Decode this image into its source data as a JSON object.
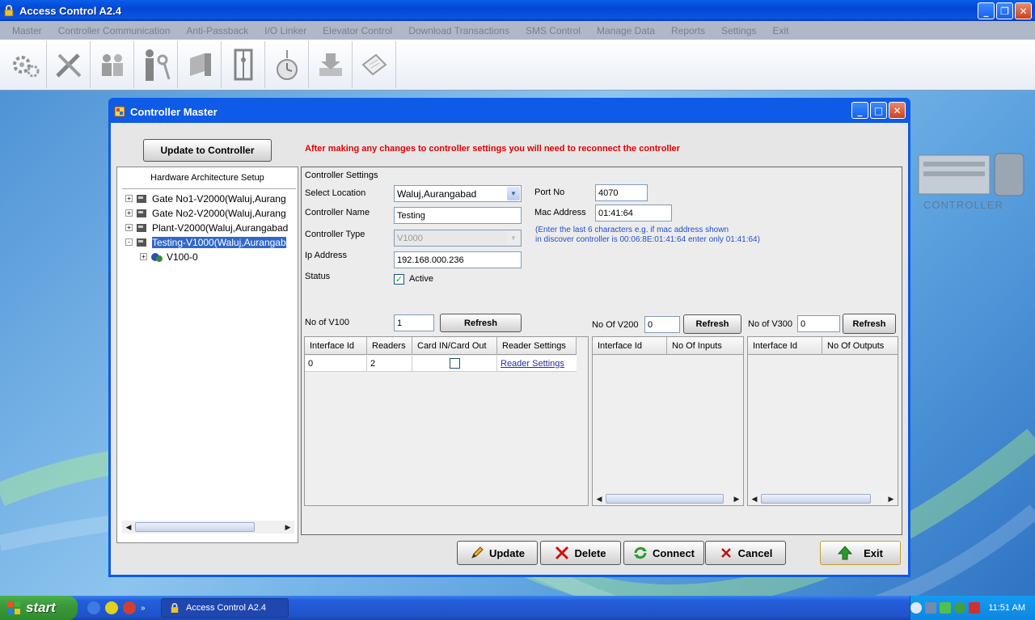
{
  "app": {
    "title": "Access Control A2.4"
  },
  "menu": [
    "Master",
    "Controller Communication",
    "Anti-Passback",
    "I/O Linker",
    "Elevator Control",
    "Download Transactions",
    "SMS Control",
    "Manage Data",
    "Reports",
    "Settings",
    "Exit"
  ],
  "toolbar": [
    "gear-icon",
    "tools-icon",
    "users-icon",
    "person-key-icon",
    "door-icon",
    "elevator-icon",
    "alarm-clock-icon",
    "download-icon",
    "document-icon"
  ],
  "desktop": {
    "controller_label": "CONTROLLER"
  },
  "dialog": {
    "title": "Controller Master",
    "update_to_controller": "Update to Controller",
    "notice": "After making any changes to controller settings you will need to reconnect the controller",
    "tree": {
      "title": "Hardware Architecture Setup",
      "nodes": [
        {
          "label": "Gate No1-V2000(Waluj,Aurang",
          "expander": "+"
        },
        {
          "label": "Gate No2-V2000(Waluj,Aurang",
          "expander": "+"
        },
        {
          "label": "Plant-V2000(Waluj,Aurangabad",
          "expander": "+"
        },
        {
          "label": "Testing-V1000(Waluj,Aurangab",
          "expander": "-"
        },
        {
          "label": "V100-0",
          "expander": "+"
        }
      ]
    },
    "settings": {
      "section_title": "Controller Settings",
      "select_location_label": "Select Location",
      "select_location_value": "Waluj,Aurangabad",
      "controller_name_label": "Controller Name",
      "controller_name_value": "Testing",
      "controller_type_label": "Controller Type",
      "controller_type_value": "V1000",
      "ip_label": "Ip Address",
      "ip_value": "192.168.000.236",
      "status_label": "Status",
      "active_label": "Active",
      "active_checked": "✓",
      "port_label": "Port No",
      "port_value": "4070",
      "mac_label": "Mac Address",
      "mac_value": "01:41:64",
      "mac_hint_line1": "(Enter the last 6 characters e.g. if mac address shown",
      "mac_hint_line2": "in discover controller is 00:06:8E:01:41:64 enter only 01:41:64)"
    },
    "v100": {
      "label": "No of V100",
      "value": "1",
      "refresh": "Refresh",
      "columns": [
        "Interface Id",
        "Readers",
        "Card IN/Card Out",
        "Reader Settings"
      ],
      "rows": [
        {
          "interface_id": "0",
          "readers": "2",
          "card_in_out": "",
          "reader_settings": "Reader Settings"
        }
      ]
    },
    "v200": {
      "label": "No Of V200",
      "value": "0",
      "refresh": "Refresh",
      "columns": [
        "Interface Id",
        "No Of Inputs"
      ]
    },
    "v300": {
      "label": "No of V300",
      "value": "0",
      "refresh": "Refresh",
      "columns": [
        "Interface Id",
        "No Of Outputs"
      ]
    },
    "buttons": {
      "update": "Update",
      "delete": "Delete",
      "connect": "Connect",
      "cancel": "Cancel",
      "exit": "Exit"
    }
  },
  "taskbar": {
    "start": "start",
    "task": "Access Control A2.4",
    "time": "11:51 AM"
  }
}
